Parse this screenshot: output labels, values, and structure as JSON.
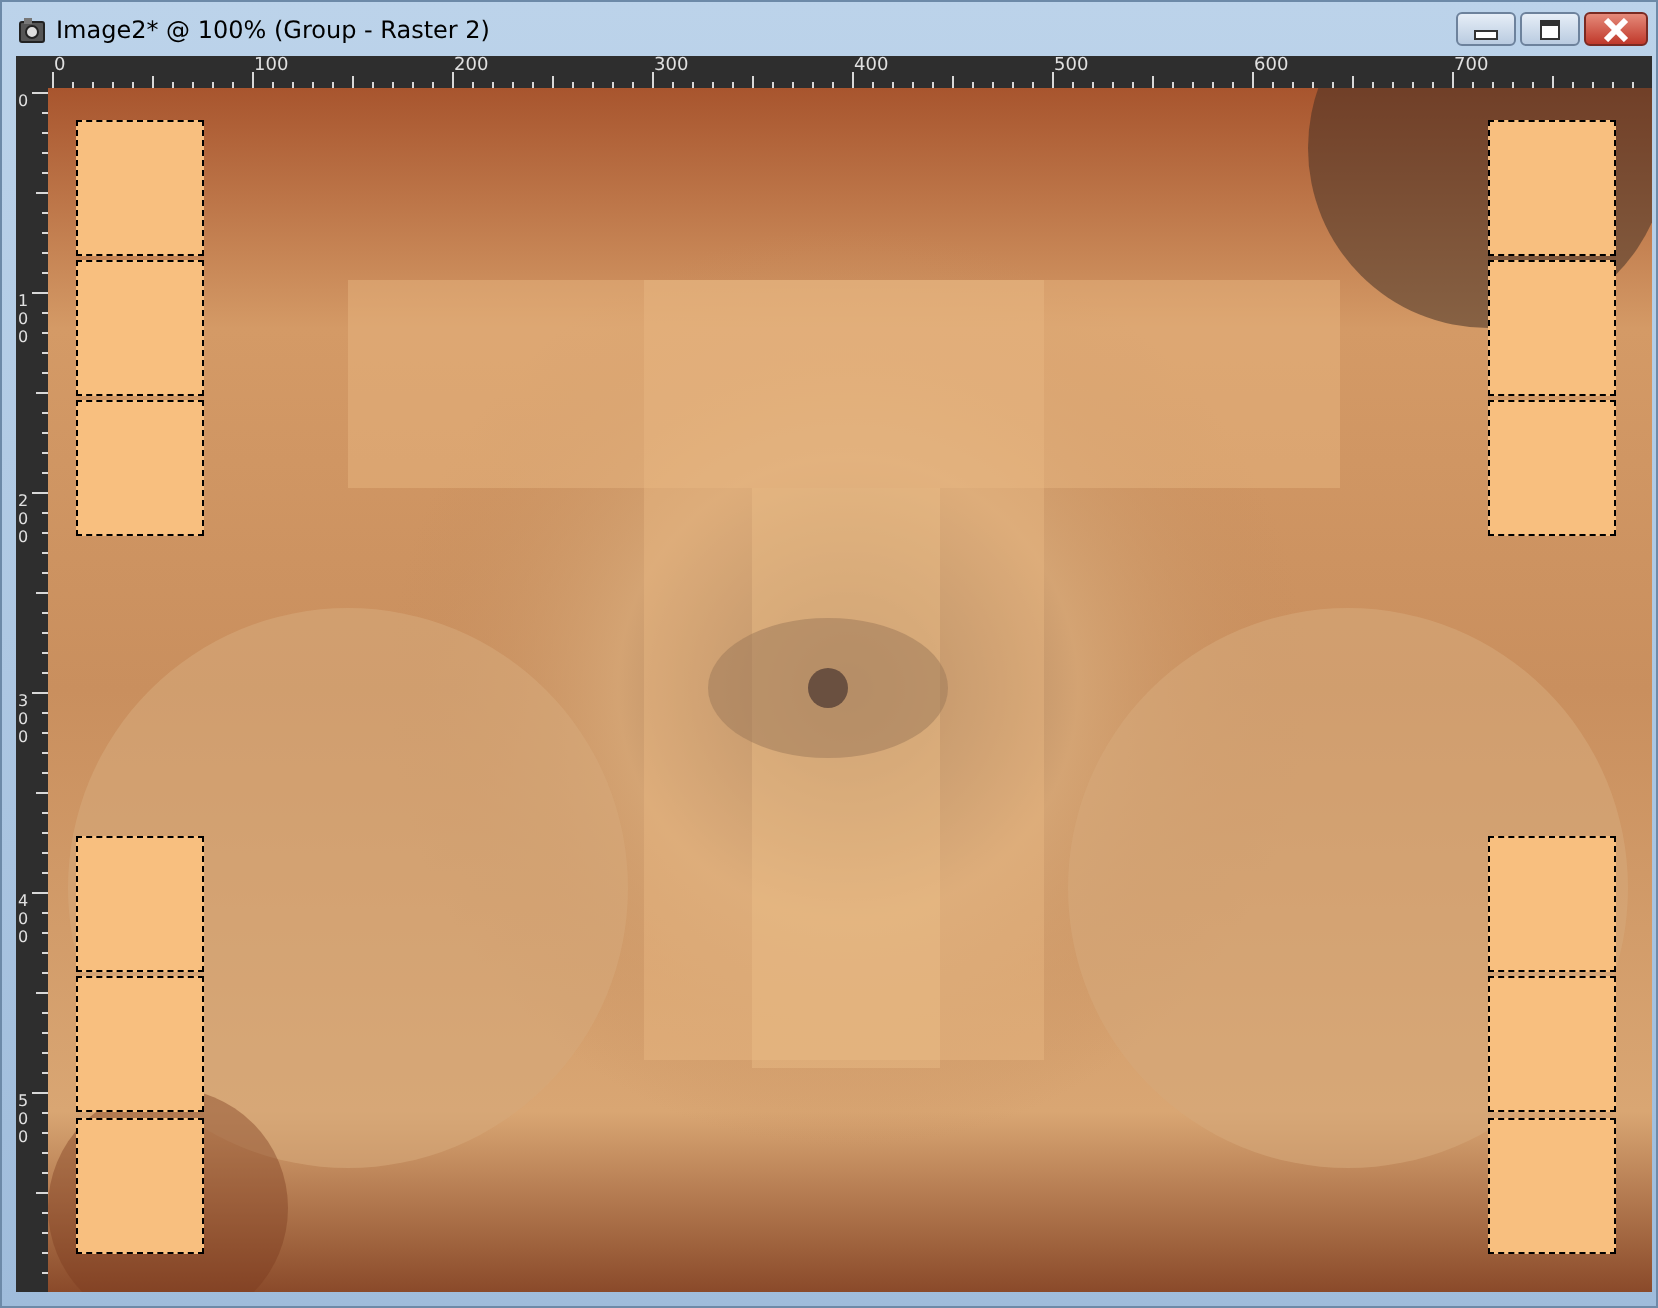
{
  "window": {
    "title": "Image2* @ 100% (Group - Raster 2)"
  },
  "rulers": {
    "horizontal": [
      "0",
      "100",
      "200",
      "300",
      "400",
      "500",
      "600",
      "700"
    ],
    "vertical": [
      "0",
      "100",
      "200",
      "300",
      "400",
      "500"
    ]
  }
}
